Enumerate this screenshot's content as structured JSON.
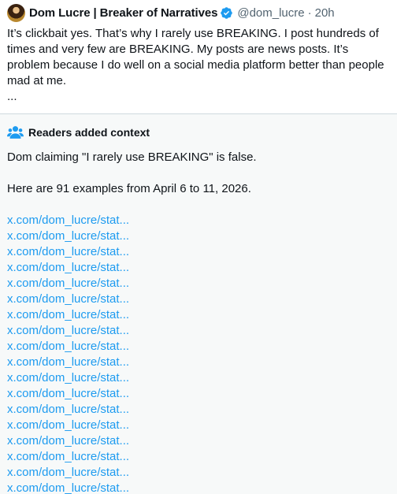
{
  "tweet": {
    "display_name": "Dom Lucre | Breaker of Narratives",
    "handle": "@dom_lucre",
    "separator": "·",
    "time": "20h",
    "text": "It’s clickbait yes. That’s why I rarely use BREAKING. I post hundreds of times and very few are BREAKING. My posts are news posts. It’s problem because I do well on a social media platform better than people mad at me.",
    "ellipsis": "...",
    "verified_color": "#1d9bf0"
  },
  "context": {
    "title": "Readers added context",
    "icon": "people-icon",
    "accent": "#1d9bf0",
    "paragraph1": "Dom claiming \"I rarely use BREAKING\" is false.",
    "paragraph2": "Here are 91 examples from April 6 to 11, 2026.",
    "links": [
      "x.com/dom_lucre/stat...",
      "x.com/dom_lucre/stat...",
      "x.com/dom_lucre/stat...",
      "x.com/dom_lucre/stat...",
      "x.com/dom_lucre/stat...",
      "x.com/dom_lucre/stat...",
      "x.com/dom_lucre/stat...",
      "x.com/dom_lucre/stat...",
      "x.com/dom_lucre/stat...",
      "x.com/dom_lucre/stat...",
      "x.com/dom_lucre/stat...",
      "x.com/dom_lucre/stat...",
      "x.com/dom_lucre/stat...",
      "x.com/dom_lucre/stat...",
      "x.com/dom_lucre/stat...",
      "x.com/dom_lucre/stat...",
      "x.com/dom_lucre/stat...",
      "x.com/dom_lucre/stat..."
    ]
  }
}
